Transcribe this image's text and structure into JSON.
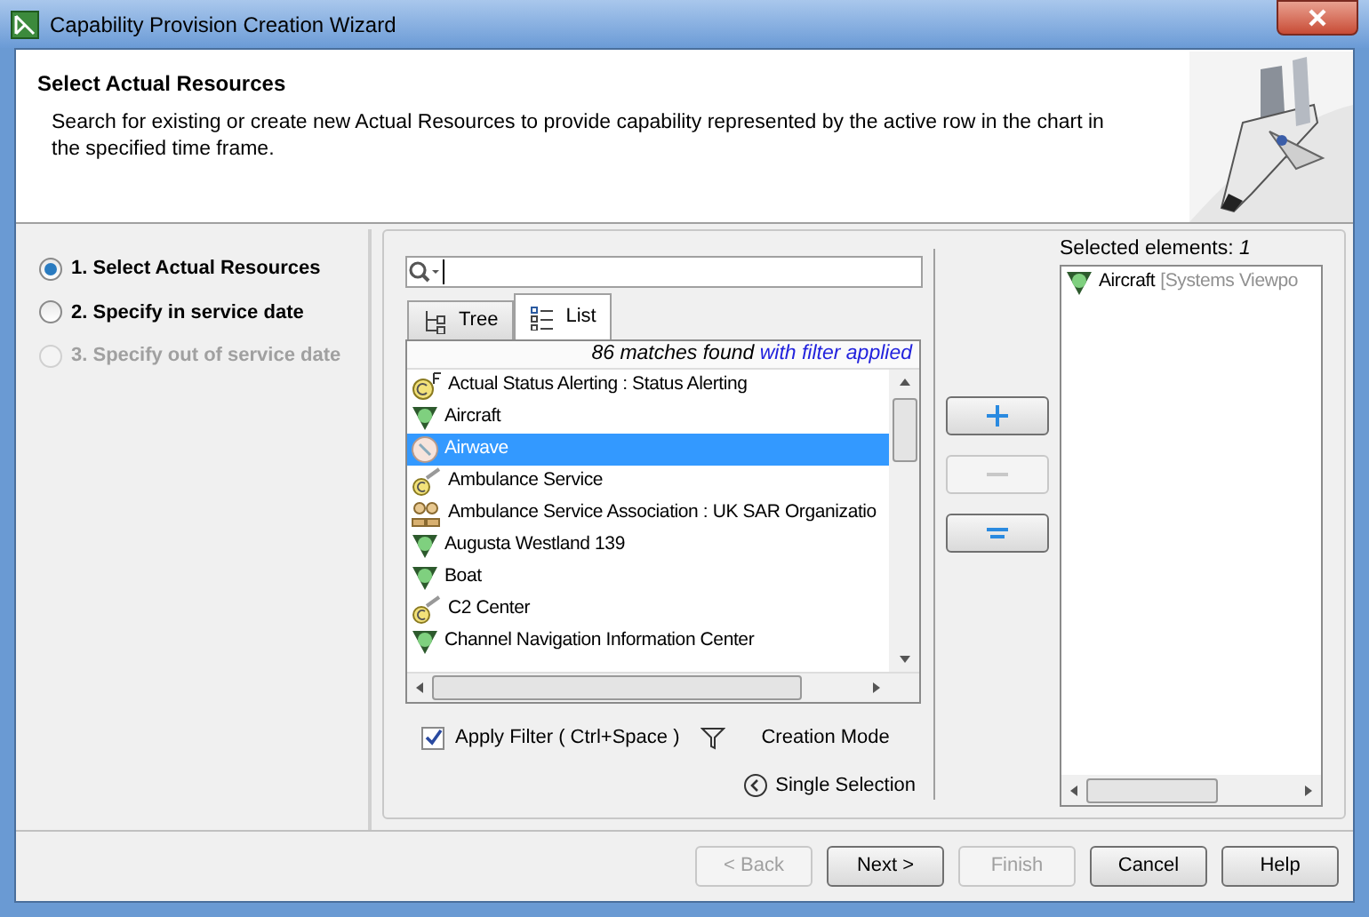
{
  "window": {
    "title": "Capability Provision Creation Wizard"
  },
  "header": {
    "title": "Select Actual Resources",
    "description": "Search for existing or create new Actual Resources to provide capability represented by the active row in the chart in the specified time frame."
  },
  "steps": [
    {
      "label": "1. Select Actual Resources",
      "selected": true,
      "disabled": false
    },
    {
      "label": "2. Specify in service date",
      "selected": false,
      "disabled": false
    },
    {
      "label": "3. Specify out of service date",
      "selected": false,
      "disabled": true
    }
  ],
  "tabs": [
    {
      "label": "Tree",
      "kind": "tree",
      "selected": false
    },
    {
      "label": "List",
      "kind": "list",
      "selected": true
    }
  ],
  "match_info": {
    "count": "86 matches found",
    "filter": "with filter applied"
  },
  "results": [
    {
      "label": "Actual Status Alerting : Status Alerting",
      "kind": "capability",
      "selected": false
    },
    {
      "label": "Aircraft",
      "kind": "performer",
      "selected": false
    },
    {
      "label": "Airwave",
      "kind": "resource",
      "selected": true
    },
    {
      "label": "Ambulance Service",
      "kind": "service",
      "selected": false
    },
    {
      "label": "Ambulance Service Association : UK SAR Organizatio",
      "kind": "organization",
      "selected": false
    },
    {
      "label": "Augusta Westland 139",
      "kind": "performer",
      "selected": false
    },
    {
      "label": "Boat",
      "kind": "performer",
      "selected": false
    },
    {
      "label": "C2 Center",
      "kind": "service",
      "selected": false
    },
    {
      "label": "Channel Navigation Information Center",
      "kind": "performer",
      "selected": false
    }
  ],
  "apply_filter": {
    "label": "Apply Filter ( Ctrl+Space )",
    "checked": true
  },
  "creation_mode": "Creation Mode",
  "single_selection": "Single Selection",
  "move_buttons": [
    {
      "kind": "add",
      "disabled": false
    },
    {
      "kind": "remove",
      "disabled": true
    },
    {
      "kind": "replace",
      "disabled": false
    }
  ],
  "selected_panel": {
    "label": "Selected elements:",
    "count": "1",
    "items": [
      {
        "name": "Aircraft",
        "owner": "[Systems Viewpo",
        "kind": "performer"
      }
    ]
  },
  "buttons": [
    {
      "label": "< Back",
      "disabled": true
    },
    {
      "label": "Next >",
      "disabled": false
    },
    {
      "label": "Finish",
      "disabled": true
    },
    {
      "label": "Cancel",
      "disabled": false
    },
    {
      "label": "Help",
      "disabled": false
    }
  ]
}
